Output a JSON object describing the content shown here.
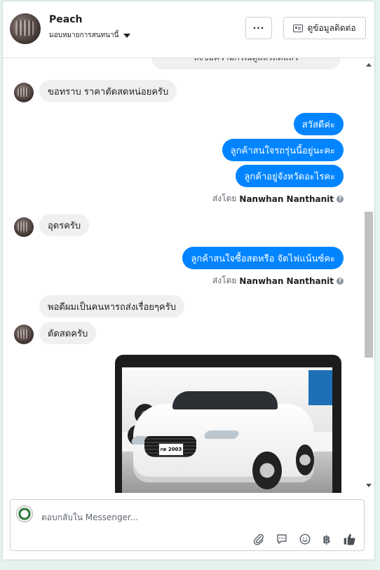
{
  "header": {
    "contact_name": "Peach",
    "assign_label": "มอบหมายการสนทนานี้",
    "more_label": "···",
    "info_button_label": "ดูข้อมูลติดต่อ"
  },
  "messages": {
    "cut_text": "ลงข้อความกรณีดูแลรถดีแล้ว",
    "m1": "ขอทราบ ราคาตัดสดหน่อยครับ",
    "m2": "สวัสดีค่ะ",
    "m3": "ลูกค้าสนใจรถรุ่นนี้อยู่นะคะ",
    "m4": "ลูกค้าอยู่จังหวัดอะไรคะ",
    "sent_by_prefix": "ส่งโดย",
    "sent_by_name": "Nanwhan Nanthanit",
    "m5": "อุดรครับ",
    "m6": "ลูกค้าสนใจซื้อสดหรือ จัดไฟแน้นซ์คะ",
    "m7": "พอดีผมเป็นคนหารถส่งเรื่อยๆครับ",
    "m8": "ตัดสดครับ",
    "plate_text": "กด 2003"
  },
  "composer": {
    "placeholder": "ตอบกลับใน Messenger...",
    "tools": [
      "paperclip-icon",
      "saved-reply-icon",
      "emoji-icon",
      "baht-icon",
      "thumbs-up-icon"
    ]
  },
  "colors": {
    "outgoing_bubble": "#0084ff",
    "incoming_bubble": "#f0f0f0",
    "background": "#e4f3ef"
  }
}
